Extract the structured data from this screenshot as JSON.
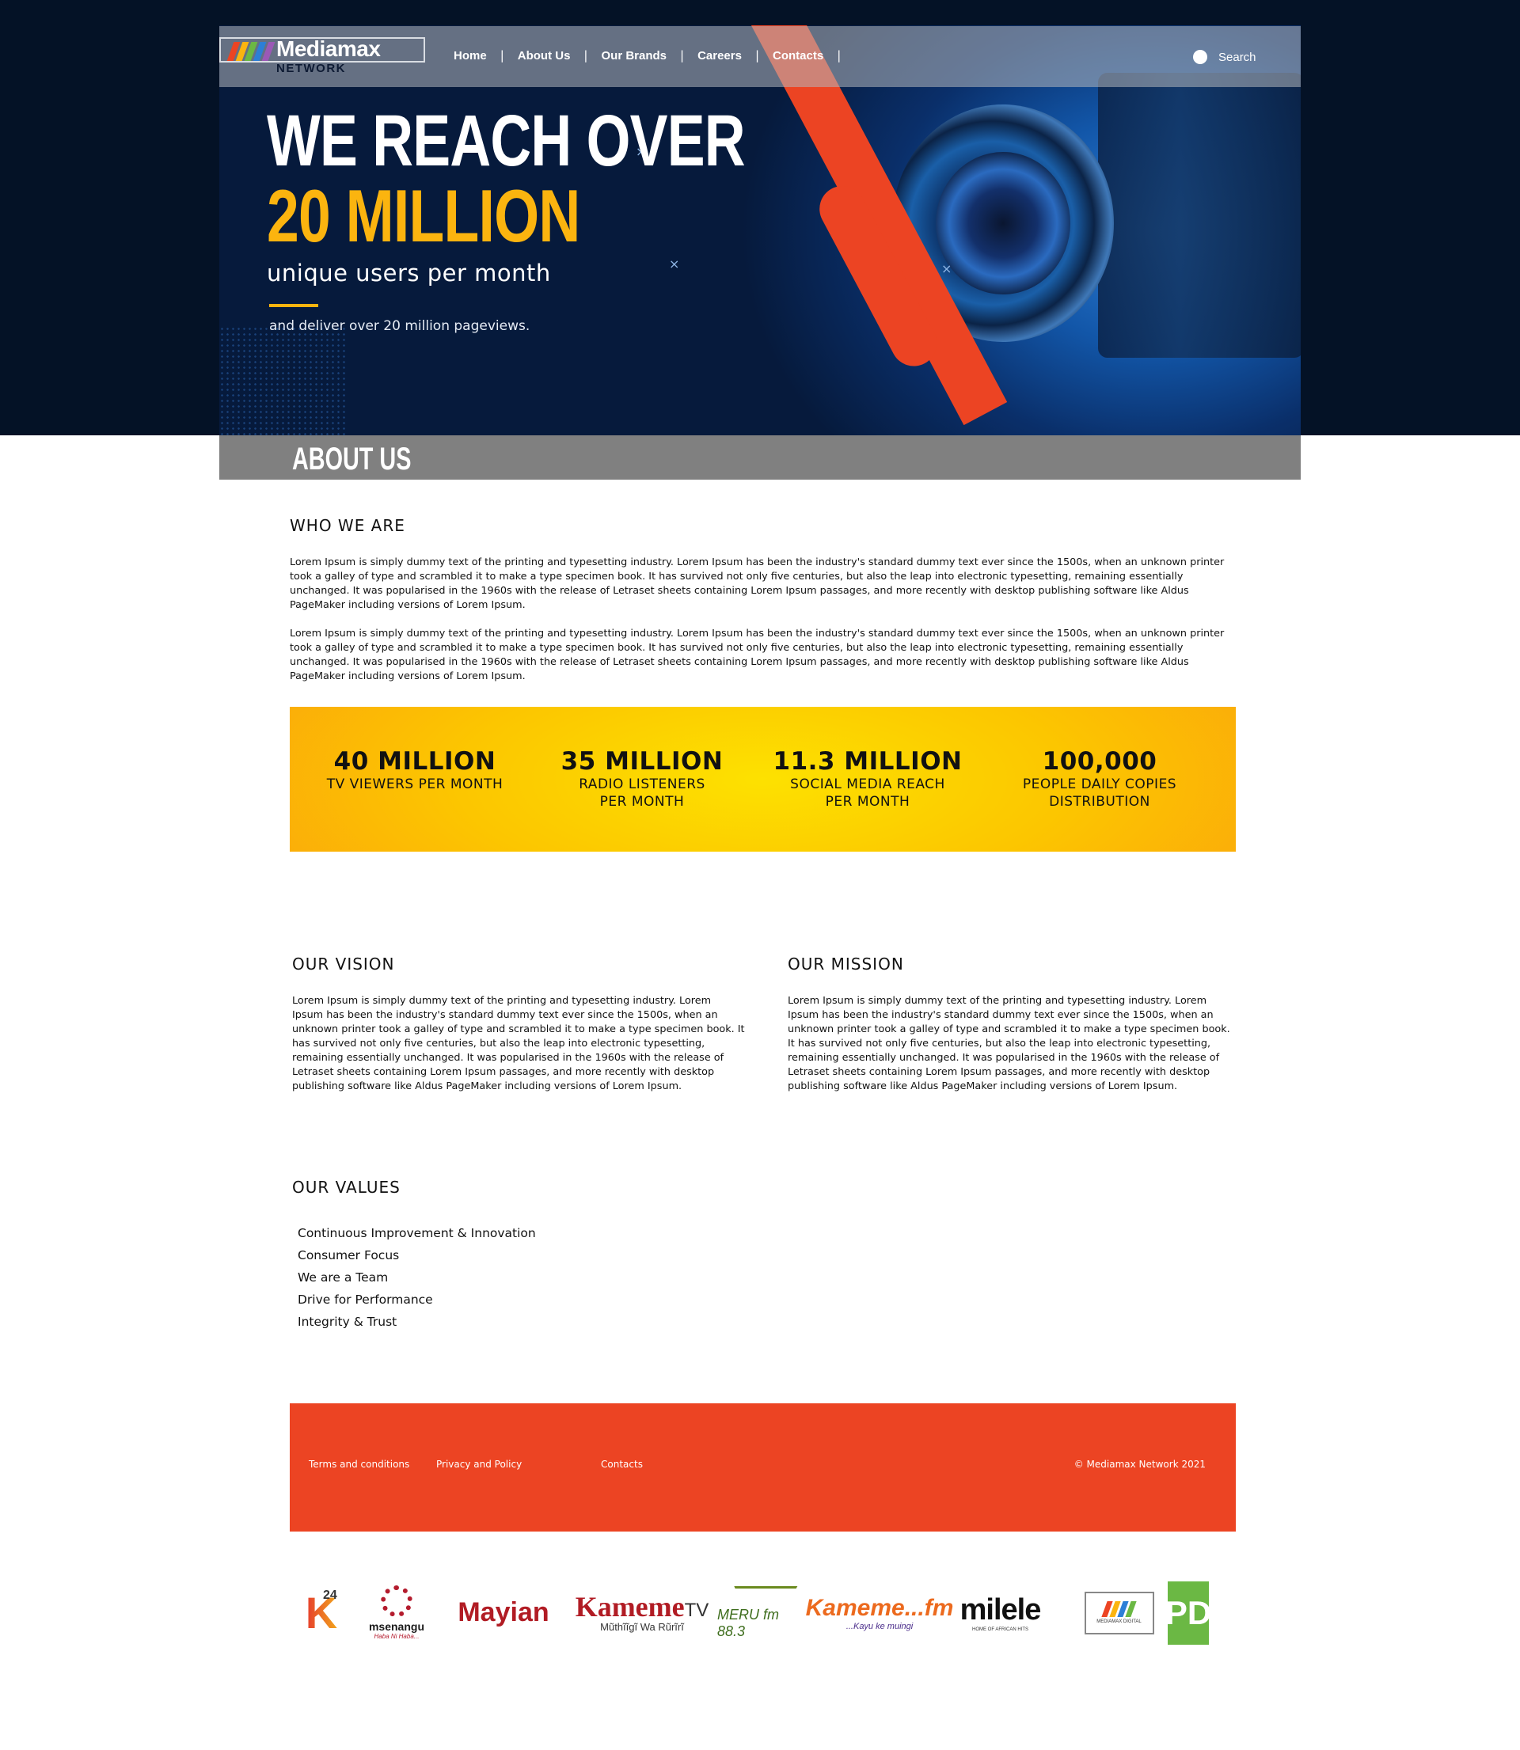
{
  "nav": {
    "logo_name": "Mediamax",
    "logo_sub": "NETWORK",
    "items": [
      "Home",
      "About Us",
      "Our Brands",
      "Careers",
      "Contacts"
    ],
    "search_label": "Search"
  },
  "hero": {
    "line1": "WE REACH OVER",
    "line2": "20 MILLION",
    "line3": "unique users per month",
    "line4": "and deliver over 20 million pageviews."
  },
  "about": {
    "title": "ABOUT US"
  },
  "who": {
    "title": "WHO WE ARE",
    "paragraphs": [
      "Lorem Ipsum is simply dummy text of the printing and typesetting industry. Lorem Ipsum has been the industry's standard dummy text ever since the 1500s, when an unknown printer took a galley of type and scrambled it to make a type specimen book. It has survived not only five centuries, but also the leap into electronic typesetting, remaining essentially unchanged. It was popularised in the 1960s with the release of Letraset sheets containing Lorem Ipsum passages, and more recently with desktop publishing software like Aldus PageMaker including versions of Lorem Ipsum.",
      "Lorem Ipsum is simply dummy text of the printing and typesetting industry. Lorem Ipsum has been the industry's standard dummy text ever since the 1500s, when an unknown printer took a galley of type and scrambled it to make a type specimen book. It has survived not only five centuries, but also the leap into electronic typesetting, remaining essentially unchanged. It was popularised in the 1960s with the release of Letraset sheets containing Lorem Ipsum passages, and more recently with desktop publishing software like Aldus PageMaker including versions of Lorem Ipsum."
    ]
  },
  "stats": [
    {
      "value": "40 MILLION",
      "label": "TV VIEWERS PER MONTH"
    },
    {
      "value": "35 MILLION",
      "label": "RADIO LISTENERS PER MONTH"
    },
    {
      "value": "11.3 MILLION",
      "label": "SOCIAL MEDIA REACH PER MONTH"
    },
    {
      "value": "100,000",
      "label": "PEOPLE DAILY COPIES DISTRIBUTION"
    }
  ],
  "vision": {
    "title": "OUR VISION",
    "text": "Lorem Ipsum is simply dummy text of the printing and typesetting industry. Lorem Ipsum has been the industry's standard dummy text ever since the 1500s, when an unknown printer took a galley of type and scrambled it to make a type specimen book. It has survived not only five centuries, but also the leap into electronic typesetting, remaining essentially unchanged. It was popularised in the 1960s with the release of Letraset sheets containing Lorem Ipsum passages, and more recently with desktop publishing software like Aldus PageMaker including versions of Lorem Ipsum."
  },
  "mission": {
    "title": "OUR MISSION",
    "text": "Lorem Ipsum is simply dummy text of the printing and typesetting industry. Lorem Ipsum has been the industry's standard dummy text ever since the 1500s, when an unknown printer took a galley of type and scrambled it to make a type specimen book. It has survived not only five centuries, but also the leap into electronic typesetting, remaining essentially unchanged. It was popularised in the 1960s with the release of Letraset sheets containing Lorem Ipsum passages, and more recently with desktop publishing software like Aldus PageMaker including versions of Lorem Ipsum."
  },
  "values": {
    "title": "OUR VALUES",
    "items": [
      "Continuous Improvement & Innovation",
      "Consumer Focus",
      "We are a Team",
      "Drive for Performance",
      "Integrity & Trust"
    ]
  },
  "footer": {
    "terms": "Terms and conditions",
    "privacy": "Privacy and Policy",
    "contacts": "Contacts",
    "copyright": "© Mediamax Network 2021"
  },
  "brands": {
    "k24": {
      "mark": "K",
      "num": "24"
    },
    "msenangu": {
      "name": "msenangu",
      "tagline": "Haba Ni Haba..."
    },
    "mayian": {
      "name": "Mayian"
    },
    "kameme_tv": {
      "name": "Kameme",
      "suffix": "TV",
      "tagline": "Mũthĩĩgĩ Wa Rũrĩrĩ"
    },
    "meru": {
      "name": "MERU fm 88.3"
    },
    "kameme_fm": {
      "name": "Kameme...fm",
      "tagline": "...Kayu ke muingi"
    },
    "milele": {
      "name": "milele",
      "tagline": "HOME OF AFRICAN HITS"
    },
    "mediamax_digital": {
      "name": "MEDIAMAX DIGITAL"
    },
    "pd": {
      "name": "PD"
    }
  },
  "colors": {
    "accent_orange": "#ec4423",
    "accent_yellow": "#fbb40f",
    "hero_navy": "#041226",
    "about_bar_gray": "#808080"
  }
}
